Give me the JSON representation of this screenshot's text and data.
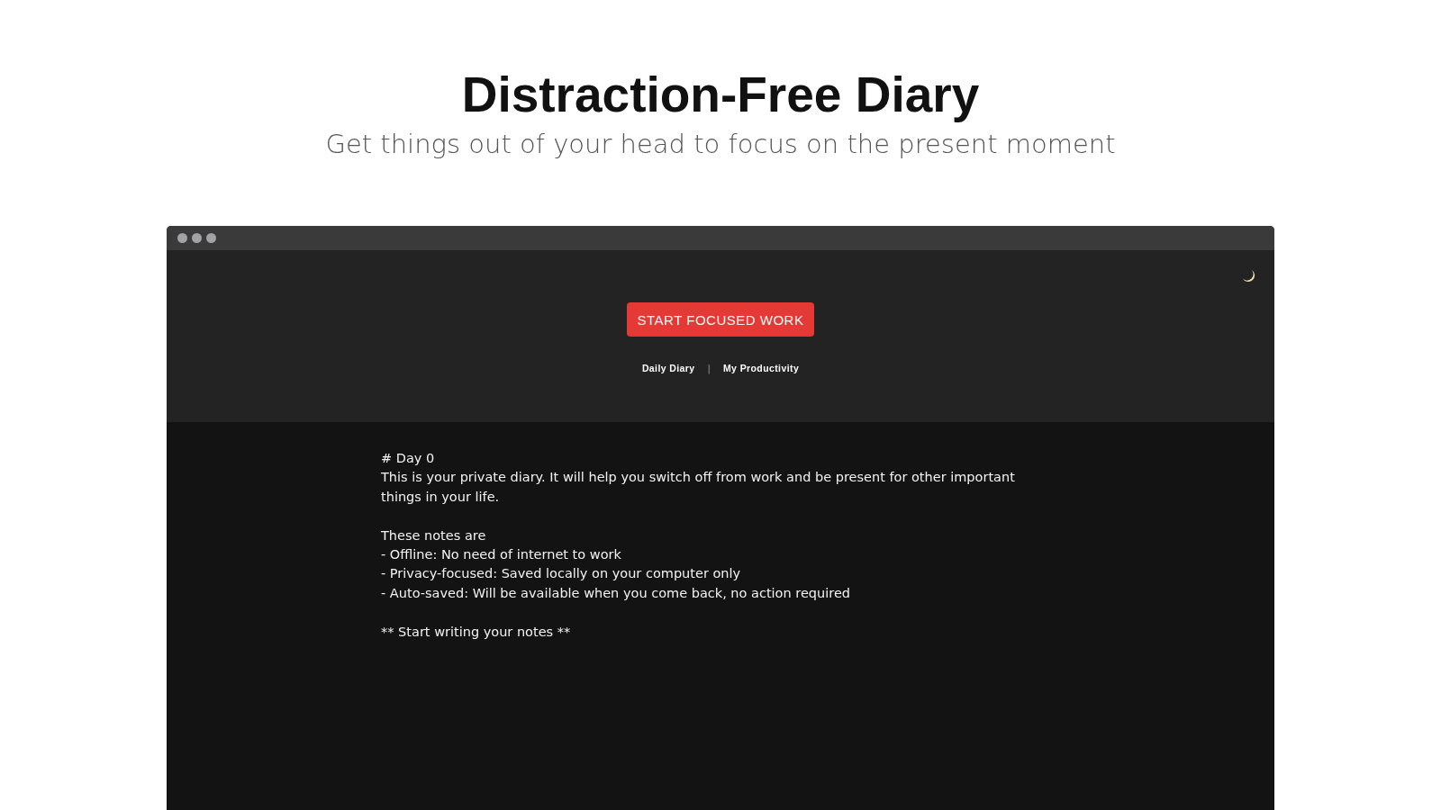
{
  "hero": {
    "title": "Distraction-Free Diary",
    "subtitle": "Get things out of your head to focus on the present moment"
  },
  "app": {
    "button": "START FOCUSED WORK",
    "nav": [
      {
        "label": "Daily Diary"
      },
      {
        "label": "My Productivity"
      }
    ],
    "nav_separator": "|",
    "editor_blocks": [
      [
        "# Day 0",
        "This is your private diary. It will help you switch off from work and be present for other important things in your life."
      ],
      [
        "These notes are",
        "- Offline: No need of internet to work",
        "- Privacy-focused: Saved locally on your computer only",
        "- Auto-saved: Will be available when you come back, no action required"
      ],
      [
        "** Start writing your notes **"
      ]
    ]
  }
}
